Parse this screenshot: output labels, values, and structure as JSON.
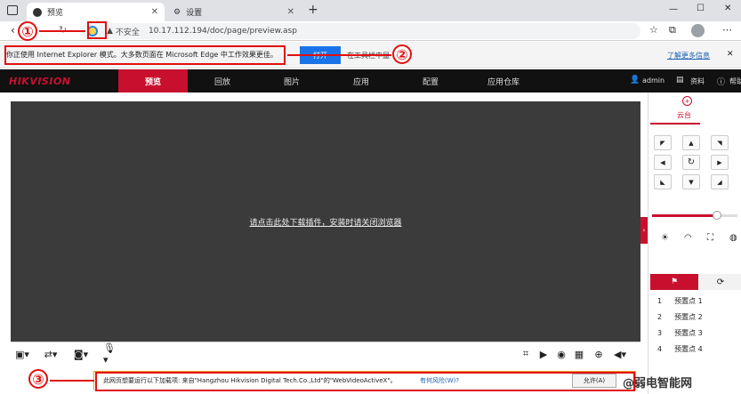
{
  "browser": {
    "tabs": [
      {
        "label": "预览"
      },
      {
        "label": "设置"
      }
    ],
    "new_tab": "+",
    "security_label": "不安全",
    "url": "10.17.112.194/doc/page/preview.asp"
  },
  "info_bar": {
    "message": "你正使用 Internet Explorer 模式。大多数页面在 Microsoft Edge 中工作效果更佳。",
    "open_button": "打开",
    "toolbar_label": "在工具栏中显",
    "learn_more": "了解更多信息"
  },
  "app": {
    "logo": "HIKVISION",
    "nav": [
      "预览",
      "回放",
      "图片",
      "应用",
      "配置",
      "应用仓库"
    ],
    "user": "admin",
    "docs": "资料",
    "help": "帮助"
  },
  "video": {
    "download_link": "请点击此处下载插件，安装时请关闭浏览器"
  },
  "ptz": {
    "title": "云台",
    "presets": [
      {
        "num": "1",
        "name": "预置点 1"
      },
      {
        "num": "2",
        "name": "预置点 2"
      },
      {
        "num": "3",
        "name": "预置点 3"
      },
      {
        "num": "4",
        "name": "预置点 4"
      }
    ]
  },
  "plugin_bar": {
    "message": "此网页想要运行以下加载项: 来自\"Hangzhou Hikvision Digital Tech.Co.,Ltd\"的\"WebVideoActiveX\"。",
    "risk_link": "有何风险(W)?",
    "allow_button": "允许(A)"
  },
  "markers": [
    "①",
    "②",
    "③"
  ],
  "watermark": "@弱电智能网",
  "colors": {
    "brand_red": "#c8102e",
    "annotation_red": "#e01010",
    "video_bg": "#3b3b3b",
    "link_blue": "#1a5fb4"
  }
}
